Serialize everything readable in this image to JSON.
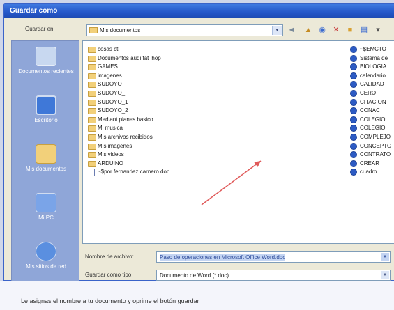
{
  "window": {
    "title": "Guardar como"
  },
  "toolbar": {
    "save_in_label": "Guardar en:",
    "location": "Mis documentos"
  },
  "places": [
    {
      "label": "Documentos recientes",
      "icon": "recent-documents-icon",
      "color": "#c8d8f0"
    },
    {
      "label": "Escritorio",
      "icon": "desktop-icon",
      "color": "#3f78d8"
    },
    {
      "label": "Mis documentos",
      "icon": "my-documents-icon",
      "color": "#f2d07a"
    },
    {
      "label": "Mi PC",
      "icon": "my-computer-icon",
      "color": "#7aa4e8"
    },
    {
      "label": "Mis sitios de red",
      "icon": "network-places-icon",
      "color": "#5a8fe0"
    }
  ],
  "files_left": [
    {
      "name": "cosas ctl",
      "type": "folder"
    },
    {
      "name": "Documentos audi fat lhop",
      "type": "folder"
    },
    {
      "name": "GAMES",
      "type": "folder"
    },
    {
      "name": "imagenes",
      "type": "folder"
    },
    {
      "name": "SUDOYO",
      "type": "folder"
    },
    {
      "name": "SUDOYO_",
      "type": "folder"
    },
    {
      "name": "SUDOYO_1",
      "type": "folder"
    },
    {
      "name": "SUDOYO_2",
      "type": "folder"
    },
    {
      "name": "Mediant planes basico",
      "type": "folder"
    },
    {
      "name": "Mi musica",
      "type": "folder"
    },
    {
      "name": "Mis archivos recibidos",
      "type": "folder"
    },
    {
      "name": "Mis imagenes",
      "type": "folder"
    },
    {
      "name": "Mis videos",
      "type": "folder"
    },
    {
      "name": "ARDUINO",
      "type": "folder"
    },
    {
      "name": "~$por fernandez carnero.doc",
      "type": "doc"
    }
  ],
  "files_right": [
    "~$EMCTO",
    "Sistema de",
    "BIOLOGIA",
    "calendario",
    "CALIDAD",
    "CERO",
    "CITACION",
    "CONAC",
    "COLEGIO",
    "COLEGIO",
    "COMPLEJO",
    "CONCEPTO",
    "CONTRATO",
    "CREAR",
    "cuadro"
  ],
  "form": {
    "filename_label": "Nombre de archivo:",
    "filename_value": "Paso de operaciones en Microsoft Office Word.doc",
    "filetype_label": "Guardar como tipo:",
    "filetype_value": "Documento de Word (*.doc)"
  },
  "caption": {
    "text": "Le asignas el nombre a tu documento y oprime el botón guardar"
  }
}
